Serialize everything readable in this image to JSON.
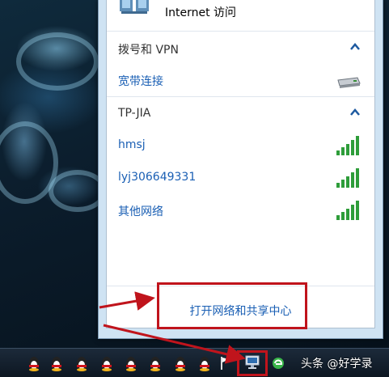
{
  "flyout": {
    "internet_status": "Internet 访问",
    "dialup_section": {
      "title": "拨号和 VPN",
      "items": [
        {
          "label": "宽带连接",
          "icon": "broadband-modem-icon"
        }
      ]
    },
    "wifi_section": {
      "title": "TP-JIA",
      "items": [
        {
          "label": "hmsj",
          "icon": "signal-strength-icon"
        },
        {
          "label": "lyj306649331",
          "icon": "signal-strength-icon"
        },
        {
          "label": "其他网络",
          "icon": "signal-strength-icon"
        }
      ]
    },
    "open_center_link": "打开网络和共享中心"
  },
  "taskbar": {
    "watermark": "头条 @好学录",
    "tray_icons": [
      "qq-penguin-icon",
      "qq-penguin-icon",
      "qq-penguin-icon",
      "qq-penguin-icon",
      "qq-penguin-icon",
      "qq-penguin-icon",
      "qq-penguin-icon",
      "qq-penguin-icon",
      "flag-icon",
      "network-icon",
      "browser-icon"
    ]
  },
  "colors": {
    "link": "#1a5fb4",
    "highlight": "#c0141c",
    "signal": "#2e9d3a"
  }
}
